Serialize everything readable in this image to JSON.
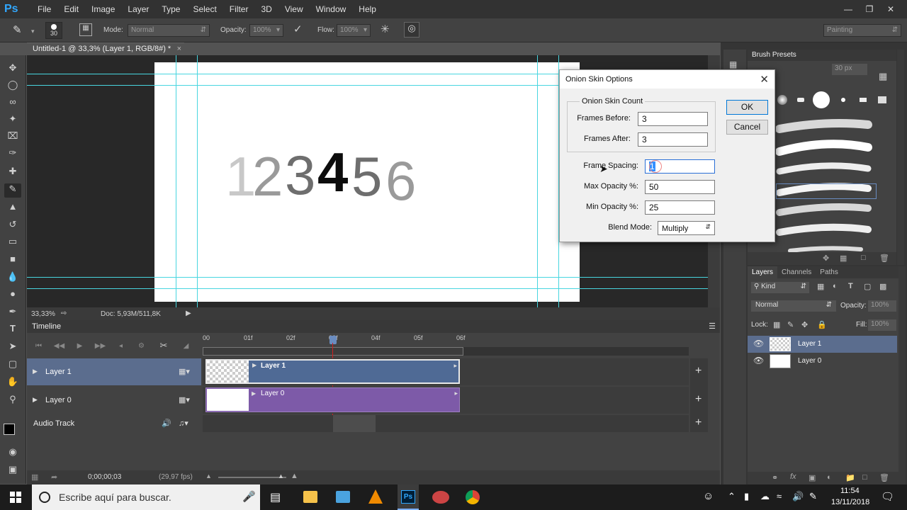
{
  "menubar": {
    "logo": "Ps",
    "items": [
      "File",
      "Edit",
      "Image",
      "Layer",
      "Type",
      "Select",
      "Filter",
      "3D",
      "View",
      "Window",
      "Help"
    ]
  },
  "options": {
    "brush_size": "30",
    "mode_label": "Mode:",
    "mode_value": "Normal",
    "opacity_label": "Opacity:",
    "opacity_value": "100%",
    "flow_label": "Flow:",
    "flow_value": "100%",
    "workspace": "Painting"
  },
  "document": {
    "tab_title": "Untitled-1 @ 33,3% (Layer 1, RGB/8#) *",
    "canvas_text": "123456",
    "zoom": "33,33%",
    "doc_size": "Doc: 5,93M/511,8K"
  },
  "timeline": {
    "title": "Timeline",
    "ruler": [
      "00",
      "01f",
      "02f",
      "03f",
      "04f",
      "05f",
      "06f"
    ],
    "layers": [
      {
        "name": "Layer 1",
        "clip": "Layer 1"
      },
      {
        "name": "Layer 0",
        "clip": "Layer 0"
      }
    ],
    "audio_track": "Audio Track",
    "timecode": "0;00;00;03",
    "fps": "(29,97 fps)"
  },
  "brush_presets": {
    "title": "Brush Presets",
    "size": "30 px"
  },
  "layers_panel": {
    "tabs": [
      "Layers",
      "Channels",
      "Paths"
    ],
    "kind": "Kind",
    "blend": "Normal",
    "opacity_label": "Opacity:",
    "opacity_value": "100%",
    "lock_label": "Lock:",
    "fill_label": "Fill:",
    "fill_value": "100%",
    "layers": [
      "Layer 1",
      "Layer 0"
    ]
  },
  "dialog": {
    "title": "Onion Skin Options",
    "group_title": "Onion Skin Count",
    "frames_before_label": "Frames Before:",
    "frames_before": "3",
    "frames_after_label": "Frames After:",
    "frames_after": "3",
    "frame_spacing_label": "Frame Spacing:",
    "frame_spacing": "1",
    "max_opacity_label": "Max Opacity %:",
    "max_opacity": "50",
    "min_opacity_label": "Min Opacity %:",
    "min_opacity": "25",
    "blend_mode_label": "Blend Mode:",
    "blend_mode": "Multiply",
    "ok": "OK",
    "cancel": "Cancel"
  },
  "taskbar": {
    "search_placeholder": "Escribe aquí para buscar.",
    "time": "11:54",
    "date": "13/11/2018"
  },
  "colors": {
    "layer1_clip": "#4f6a95",
    "layer0_clip": "#7d5aa8",
    "guide": "#48d6e0",
    "playhead": "#d02020"
  }
}
